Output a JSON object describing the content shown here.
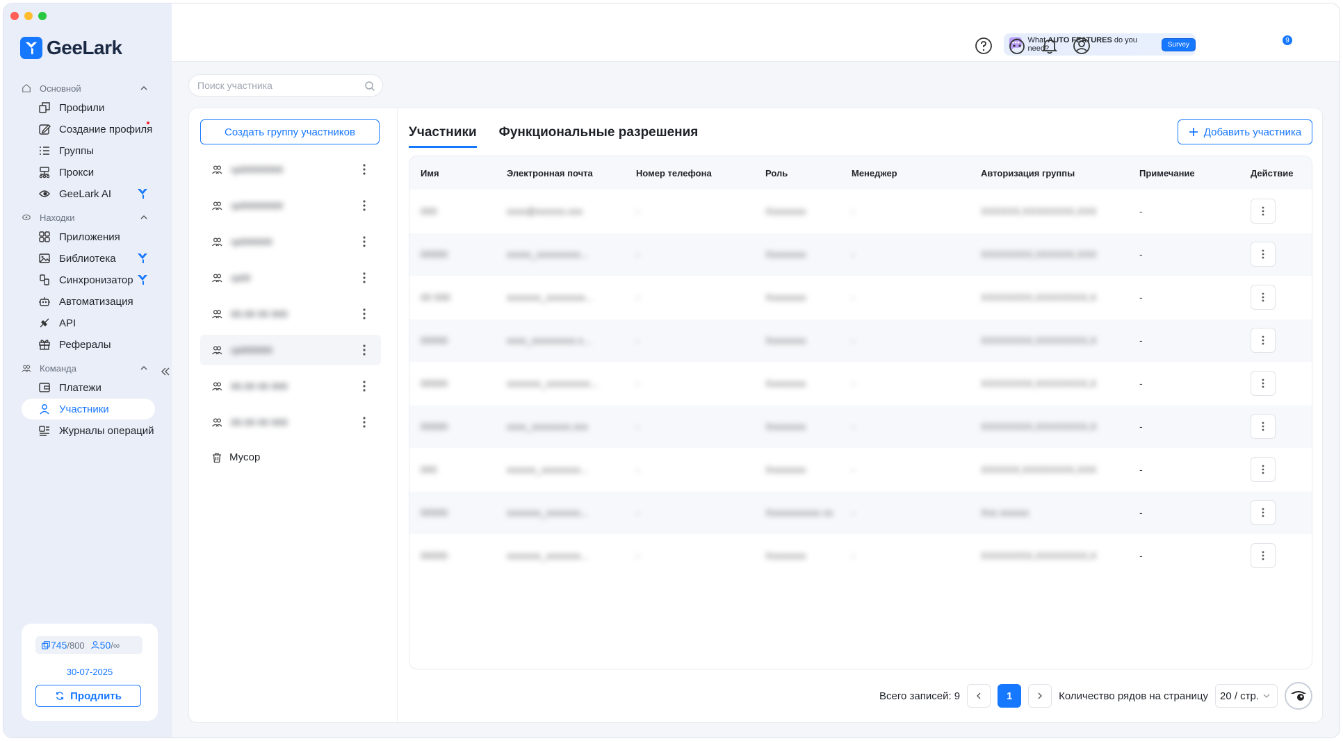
{
  "brand": {
    "name": "GeeLark",
    "color": "#1677ff"
  },
  "sidebar": {
    "sections": [
      {
        "label": "Основной",
        "icon": "home-icon",
        "items": [
          {
            "label": "Профили",
            "icon": "profiles-icon"
          },
          {
            "label": "Создание профиля",
            "icon": "edit-icon",
            "dot": true
          },
          {
            "label": "Группы",
            "icon": "list-icon"
          },
          {
            "label": "Прокси",
            "icon": "proxy-icon"
          },
          {
            "label": "GeeLark AI",
            "icon": "ai-icon",
            "badge": true
          }
        ]
      },
      {
        "label": "Находки",
        "icon": "discover-icon",
        "items": [
          {
            "label": "Приложения",
            "icon": "apps-icon"
          },
          {
            "label": "Библиотека",
            "icon": "library-icon",
            "badge": true
          },
          {
            "label": "Синхронизатор",
            "icon": "sync-icon",
            "badge": true
          },
          {
            "label": "Автоматизация",
            "icon": "robot-icon"
          },
          {
            "label": "API",
            "icon": "api-icon"
          },
          {
            "label": "Рефералы",
            "icon": "gift-icon"
          }
        ]
      },
      {
        "label": "Команда",
        "icon": "team-icon",
        "items": [
          {
            "label": "Платежи",
            "icon": "payment-icon"
          },
          {
            "label": "Участники",
            "icon": "user-icon",
            "active": true
          },
          {
            "label": "Журналы операций",
            "icon": "log-icon"
          }
        ]
      }
    ],
    "quota": {
      "profiles_used": "745",
      "profiles_total": "/800",
      "members_used": "50",
      "members_total": "/∞",
      "expiry": "30-07-2025",
      "renew_label": "Продлить"
    }
  },
  "header": {
    "survey_prefix": "What",
    "survey_bold": "AUTO FEATURES",
    "survey_suffix": "do you need?",
    "survey_button": "Survey",
    "notification_count": "9"
  },
  "search": {
    "placeholder": "Поиск участника"
  },
  "groups": {
    "create_label": "Создать группу участников",
    "items": [
      {
        "name": "гр00000000"
      },
      {
        "name": "гр00000000"
      },
      {
        "name": "гр000000"
      },
      {
        "name": "гр00"
      },
      {
        "name": "00.00 00 000"
      },
      {
        "name": "гр000000",
        "selected": true
      },
      {
        "name": "00.00 00 000"
      },
      {
        "name": "00.00 00 000"
      }
    ],
    "trash_label": "Мусор"
  },
  "tabs": [
    {
      "label": "Участники",
      "active": true
    },
    {
      "label": "Функциональные разрешения",
      "active": false
    }
  ],
  "add_member_label": "Добавить участника",
  "table": {
    "columns": [
      "Имя",
      "Электронная почта",
      "Номер телефона",
      "Роль",
      "Менеджер",
      "Авторизация группы",
      "Примечание",
      "Действие"
    ],
    "rows": [
      [
        "000",
        "xxxx@xxxxxx.xxx",
        "-",
        "Xxxxxxxx",
        "-",
        "XXXXXX,XXXXXXXX,XXX",
        "-"
      ],
      [
        "00000",
        "xxxxx_xxxxxxxxx...",
        "-",
        "Xxxxxxxx",
        "-",
        "XXXXXXXX,XXXXXX,XXX",
        "-"
      ],
      [
        "00 000",
        "xxxxxxx_xxxxxxxx...",
        "-",
        "Xxxxxxxx",
        "-",
        "XXXXXXXX,XXXXXXXX,X",
        "-"
      ],
      [
        "00000",
        "xxxx_xxxxxxxxx.x...",
        "-",
        "Xxxxxxxx",
        "-",
        "XXXXXXXX,XXXXXXXX,X",
        "-"
      ],
      [
        "00000",
        "xxxxxxx_xxxxxxxxx...",
        "-",
        "Xxxxxxxx",
        "-",
        "XXXXXXXX,XXXXXXXX,X",
        "-"
      ],
      [
        "00000",
        "xxxx_xxxxxxxx.xxx",
        "-",
        "Xxxxxxxx",
        "-",
        "XXXXXXXX,XXXXXXXX,X",
        "-"
      ],
      [
        "000",
        "xxxxxx_xxxxxxxx...",
        "-",
        "Xxxxxxxx",
        "-",
        "XXXXXX,XXXXXXXX,XXX",
        "-"
      ],
      [
        "00000",
        "xxxxxxx_xxxxxxx...",
        "-",
        "Xxxxxxxxxxx xx",
        "-",
        "Xxx xxxxxx",
        "-"
      ],
      [
        "00000",
        "xxxxxxx_xxxxxxx...",
        "-",
        "Xxxxxxxx",
        "-",
        "XXXXXXXX,XXXXXXXX,X",
        "-"
      ]
    ]
  },
  "pagination": {
    "total_label": "Всего записей: 9",
    "current_page": "1",
    "rows_label": "Количество рядов на страницу",
    "page_size": "20 / стр."
  }
}
